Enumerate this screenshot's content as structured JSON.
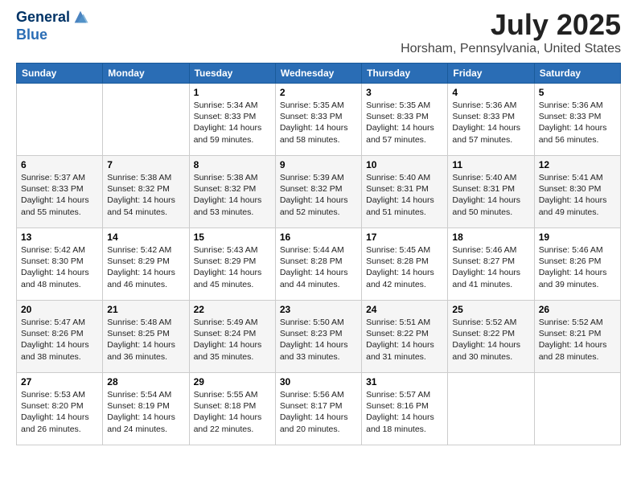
{
  "header": {
    "logo_line1": "General",
    "logo_line2": "Blue",
    "month": "July 2025",
    "location": "Horsham, Pennsylvania, United States"
  },
  "weekdays": [
    "Sunday",
    "Monday",
    "Tuesday",
    "Wednesday",
    "Thursday",
    "Friday",
    "Saturday"
  ],
  "weeks": [
    [
      null,
      null,
      {
        "day": 1,
        "sunrise": "5:34 AM",
        "sunset": "8:33 PM",
        "daylight": "14 hours and 59 minutes."
      },
      {
        "day": 2,
        "sunrise": "5:35 AM",
        "sunset": "8:33 PM",
        "daylight": "14 hours and 58 minutes."
      },
      {
        "day": 3,
        "sunrise": "5:35 AM",
        "sunset": "8:33 PM",
        "daylight": "14 hours and 57 minutes."
      },
      {
        "day": 4,
        "sunrise": "5:36 AM",
        "sunset": "8:33 PM",
        "daylight": "14 hours and 57 minutes."
      },
      {
        "day": 5,
        "sunrise": "5:36 AM",
        "sunset": "8:33 PM",
        "daylight": "14 hours and 56 minutes."
      }
    ],
    [
      {
        "day": 6,
        "sunrise": "5:37 AM",
        "sunset": "8:33 PM",
        "daylight": "14 hours and 55 minutes."
      },
      {
        "day": 7,
        "sunrise": "5:38 AM",
        "sunset": "8:32 PM",
        "daylight": "14 hours and 54 minutes."
      },
      {
        "day": 8,
        "sunrise": "5:38 AM",
        "sunset": "8:32 PM",
        "daylight": "14 hours and 53 minutes."
      },
      {
        "day": 9,
        "sunrise": "5:39 AM",
        "sunset": "8:32 PM",
        "daylight": "14 hours and 52 minutes."
      },
      {
        "day": 10,
        "sunrise": "5:40 AM",
        "sunset": "8:31 PM",
        "daylight": "14 hours and 51 minutes."
      },
      {
        "day": 11,
        "sunrise": "5:40 AM",
        "sunset": "8:31 PM",
        "daylight": "14 hours and 50 minutes."
      },
      {
        "day": 12,
        "sunrise": "5:41 AM",
        "sunset": "8:30 PM",
        "daylight": "14 hours and 49 minutes."
      }
    ],
    [
      {
        "day": 13,
        "sunrise": "5:42 AM",
        "sunset": "8:30 PM",
        "daylight": "14 hours and 48 minutes."
      },
      {
        "day": 14,
        "sunrise": "5:42 AM",
        "sunset": "8:29 PM",
        "daylight": "14 hours and 46 minutes."
      },
      {
        "day": 15,
        "sunrise": "5:43 AM",
        "sunset": "8:29 PM",
        "daylight": "14 hours and 45 minutes."
      },
      {
        "day": 16,
        "sunrise": "5:44 AM",
        "sunset": "8:28 PM",
        "daylight": "14 hours and 44 minutes."
      },
      {
        "day": 17,
        "sunrise": "5:45 AM",
        "sunset": "8:28 PM",
        "daylight": "14 hours and 42 minutes."
      },
      {
        "day": 18,
        "sunrise": "5:46 AM",
        "sunset": "8:27 PM",
        "daylight": "14 hours and 41 minutes."
      },
      {
        "day": 19,
        "sunrise": "5:46 AM",
        "sunset": "8:26 PM",
        "daylight": "14 hours and 39 minutes."
      }
    ],
    [
      {
        "day": 20,
        "sunrise": "5:47 AM",
        "sunset": "8:26 PM",
        "daylight": "14 hours and 38 minutes."
      },
      {
        "day": 21,
        "sunrise": "5:48 AM",
        "sunset": "8:25 PM",
        "daylight": "14 hours and 36 minutes."
      },
      {
        "day": 22,
        "sunrise": "5:49 AM",
        "sunset": "8:24 PM",
        "daylight": "14 hours and 35 minutes."
      },
      {
        "day": 23,
        "sunrise": "5:50 AM",
        "sunset": "8:23 PM",
        "daylight": "14 hours and 33 minutes."
      },
      {
        "day": 24,
        "sunrise": "5:51 AM",
        "sunset": "8:22 PM",
        "daylight": "14 hours and 31 minutes."
      },
      {
        "day": 25,
        "sunrise": "5:52 AM",
        "sunset": "8:22 PM",
        "daylight": "14 hours and 30 minutes."
      },
      {
        "day": 26,
        "sunrise": "5:52 AM",
        "sunset": "8:21 PM",
        "daylight": "14 hours and 28 minutes."
      }
    ],
    [
      {
        "day": 27,
        "sunrise": "5:53 AM",
        "sunset": "8:20 PM",
        "daylight": "14 hours and 26 minutes."
      },
      {
        "day": 28,
        "sunrise": "5:54 AM",
        "sunset": "8:19 PM",
        "daylight": "14 hours and 24 minutes."
      },
      {
        "day": 29,
        "sunrise": "5:55 AM",
        "sunset": "8:18 PM",
        "daylight": "14 hours and 22 minutes."
      },
      {
        "day": 30,
        "sunrise": "5:56 AM",
        "sunset": "8:17 PM",
        "daylight": "14 hours and 20 minutes."
      },
      {
        "day": 31,
        "sunrise": "5:57 AM",
        "sunset": "8:16 PM",
        "daylight": "14 hours and 18 minutes."
      },
      null,
      null
    ]
  ]
}
